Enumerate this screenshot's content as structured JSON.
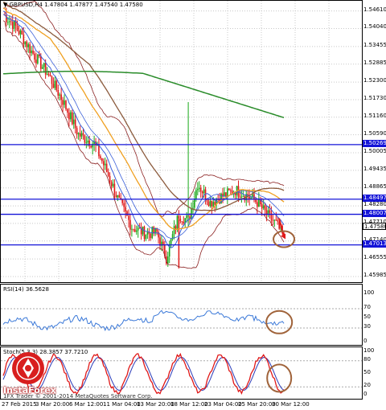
{
  "header": {
    "symbol_tf": "GBPUSD,H4",
    "ohlc": "1.47804 1.47877 1.47540 1.47580"
  },
  "main_scale": [
    {
      "label": "1.54610",
      "value": 1.5461
    },
    {
      "label": "1.54040",
      "value": 1.5404
    },
    {
      "label": "1.53455",
      "value": 1.53455
    },
    {
      "label": "1.52885",
      "value": 1.52885
    },
    {
      "label": "1.52300",
      "value": 1.523
    },
    {
      "label": "1.51730",
      "value": 1.5173
    },
    {
      "label": "1.51160",
      "value": 1.5116
    },
    {
      "label": "1.50590",
      "value": 1.5059
    },
    {
      "label": "1.50005",
      "value": 1.50005
    },
    {
      "label": "1.49435",
      "value": 1.49435
    },
    {
      "label": "1.48865",
      "value": 1.48865
    },
    {
      "label": "1.48280",
      "value": 1.4828
    },
    {
      "label": "1.47710",
      "value": 1.4771
    },
    {
      "label": "1.47140",
      "value": 1.4714
    },
    {
      "label": "1.46555",
      "value": 1.46555
    },
    {
      "label": "1.45985",
      "value": 1.45985
    }
  ],
  "main_range": [
    1.4575,
    1.5494
  ],
  "levels": [
    {
      "label": "1.50269",
      "value": 1.50269
    },
    {
      "label": "1.48497",
      "value": 1.48497
    },
    {
      "label": "1.48007",
      "value": 1.48007
    },
    {
      "label": "1.47013",
      "value": 1.47013
    }
  ],
  "current_price": {
    "label": "1.47580",
    "value": 1.4758
  },
  "colors": {
    "level_line": "#1414d8",
    "candle_up": "#18a818",
    "candle_down": "#e01818",
    "ma_fast": "#3a5fd8",
    "ma_mid": "#f0a020",
    "ma_slow": "#8b5a3c",
    "ma_long": "#2a8c2a",
    "bands": "#8b2020",
    "rsi": "#3a78d8",
    "stoch_main": "#e01818",
    "stoch_signal": "#2a3ab8",
    "circle": "#a0633a",
    "arrow": "#e01818"
  },
  "rsi": {
    "title": "RSI(14) 36.5628",
    "scale": [
      {
        "label": "100",
        "value": 100
      },
      {
        "label": "70",
        "value": 70
      },
      {
        "label": "50",
        "value": 50
      },
      {
        "label": "30",
        "value": 30
      },
      {
        "label": "0",
        "value": 0
      }
    ]
  },
  "stoch": {
    "title": "Stoch(5,3,3) 28.3857 37.7210",
    "scale": [
      {
        "label": "100",
        "value": 100
      },
      {
        "label": "80",
        "value": 80
      },
      {
        "label": "50",
        "value": 50
      },
      {
        "label": "20",
        "value": 20
      },
      {
        "label": "0",
        "value": 0
      }
    ]
  },
  "watermark": "1FX Trader © 2001-2014 MetaQuotes Software Corp.",
  "brand": "InstaForex",
  "time_axis": [
    "27 Feb 2015",
    "3 Mar 20:00",
    "6 Mar 12:00",
    "11 Mar 04:00",
    "13 Mar 20:00",
    "18 Mar 12:00",
    "23 Mar 04:00",
    "25 Mar 20:00",
    "30 Mar 12:00"
  ]
}
